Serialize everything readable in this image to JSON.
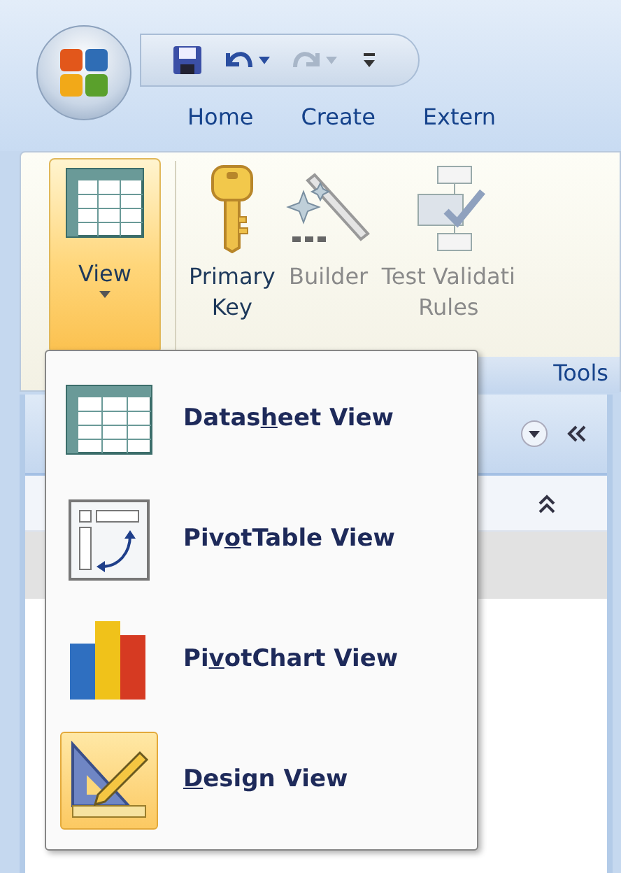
{
  "quick_access": {
    "undo_enabled": true,
    "redo_enabled": false
  },
  "tabs": [
    {
      "label": "Home"
    },
    {
      "label": "Create"
    },
    {
      "label": "Extern"
    }
  ],
  "view_button": {
    "label": "View",
    "expanded": true
  },
  "tools_group": {
    "caption": "Tools",
    "buttons": [
      {
        "kind": "key",
        "lines": [
          "Primary",
          "Key"
        ],
        "disabled": false
      },
      {
        "kind": "builder",
        "lines": [
          "Builder"
        ],
        "disabled": true
      },
      {
        "kind": "rules",
        "lines": [
          "Test Validati",
          "Rules"
        ],
        "disabled": true
      }
    ]
  },
  "view_menu": [
    {
      "kind": "datasheet",
      "before": "Datas",
      "key": "h",
      "after": "eet View",
      "selected": false
    },
    {
      "kind": "pivottable",
      "before": "Piv",
      "key": "o",
      "after": "tTable View",
      "selected": false
    },
    {
      "kind": "pivotchart",
      "before": "Pi",
      "key": "v",
      "after": "otChart View",
      "selected": false
    },
    {
      "kind": "design",
      "key": "D",
      "after": "esign View",
      "selected": true
    }
  ]
}
